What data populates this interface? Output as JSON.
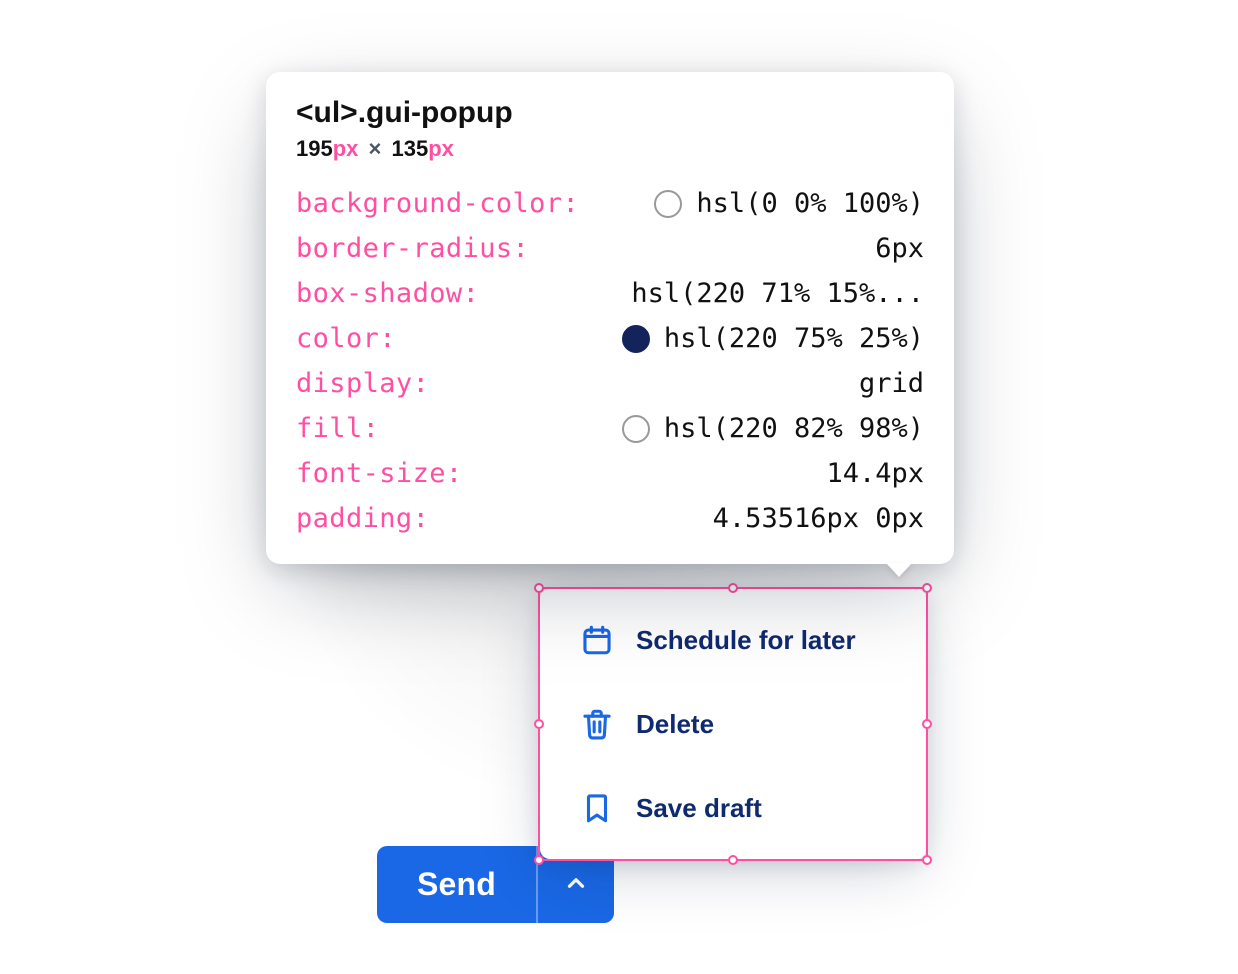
{
  "inspector": {
    "element_tag": "<ul>",
    "element_class": ".gui-popup",
    "dims": {
      "w": "195",
      "w_unit": "px",
      "sep": "×",
      "h": "135",
      "h_unit": "px"
    },
    "props": [
      {
        "key": "background-color",
        "value": "hsl(0 0% 100%)",
        "swatch": "light"
      },
      {
        "key": "border-radius",
        "value": "6px",
        "swatch": null
      },
      {
        "key": "box-shadow",
        "value": "hsl(220 71% 15%...",
        "swatch": null
      },
      {
        "key": "color",
        "value": "hsl(220 75% 25%)",
        "swatch": "dark"
      },
      {
        "key": "display",
        "value": "grid",
        "swatch": null
      },
      {
        "key": "fill",
        "value": "hsl(220 82% 98%)",
        "swatch": "light"
      },
      {
        "key": "font-size",
        "value": "14.4px",
        "swatch": null
      },
      {
        "key": "padding",
        "value": "4.53516px 0px",
        "swatch": null
      }
    ]
  },
  "popup": {
    "items": [
      {
        "icon": "calendar-icon",
        "label": "Schedule for later"
      },
      {
        "icon": "trash-icon",
        "label": "Delete"
      },
      {
        "icon": "bookmark-icon",
        "label": "Save draft"
      }
    ]
  },
  "send": {
    "label": "Send"
  }
}
